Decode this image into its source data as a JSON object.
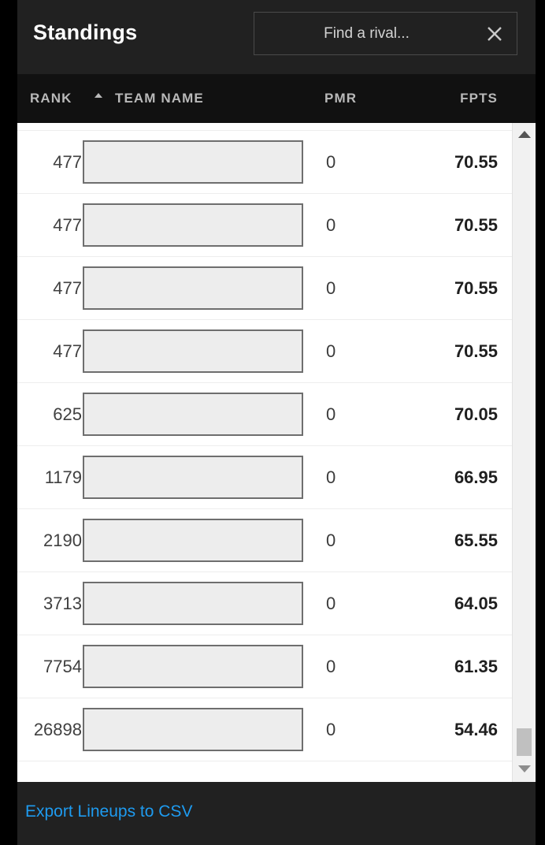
{
  "header": {
    "title": "Standings",
    "search": {
      "placeholder": "Find a rival...",
      "value": "",
      "clear_icon": "close-icon"
    }
  },
  "columns": {
    "rank": "RANK",
    "rank_sort_direction": "asc",
    "team_name": "TEAM NAME",
    "pmr": "PMR",
    "fpts": "FPTS"
  },
  "rows": [
    {
      "rank": "477",
      "team_name": "",
      "pmr": "0",
      "fpts": "70.55"
    },
    {
      "rank": "477",
      "team_name": "",
      "pmr": "0",
      "fpts": "70.55"
    },
    {
      "rank": "477",
      "team_name": "",
      "pmr": "0",
      "fpts": "70.55"
    },
    {
      "rank": "477",
      "team_name": "",
      "pmr": "0",
      "fpts": "70.55"
    },
    {
      "rank": "625",
      "team_name": "",
      "pmr": "0",
      "fpts": "70.05"
    },
    {
      "rank": "1179",
      "team_name": "",
      "pmr": "0",
      "fpts": "66.95"
    },
    {
      "rank": "2190",
      "team_name": "",
      "pmr": "0",
      "fpts": "65.55"
    },
    {
      "rank": "3713",
      "team_name": "",
      "pmr": "0",
      "fpts": "64.05"
    },
    {
      "rank": "7754",
      "team_name": "",
      "pmr": "0",
      "fpts": "61.35"
    },
    {
      "rank": "26898",
      "team_name": "",
      "pmr": "0",
      "fpts": "54.46"
    }
  ],
  "footer": {
    "export_label": "Export Lineups to CSV"
  },
  "colors": {
    "titlebar_bg": "#212121",
    "column_header_bg": "#111111",
    "list_bg": "#ffffff",
    "link_blue": "#1e9bf0",
    "team_box_fill": "#ededed",
    "team_box_border": "#6e6e6e",
    "scrollbar_track": "#f1f1f1",
    "scrollbar_thumb": "#c0c0c0"
  }
}
